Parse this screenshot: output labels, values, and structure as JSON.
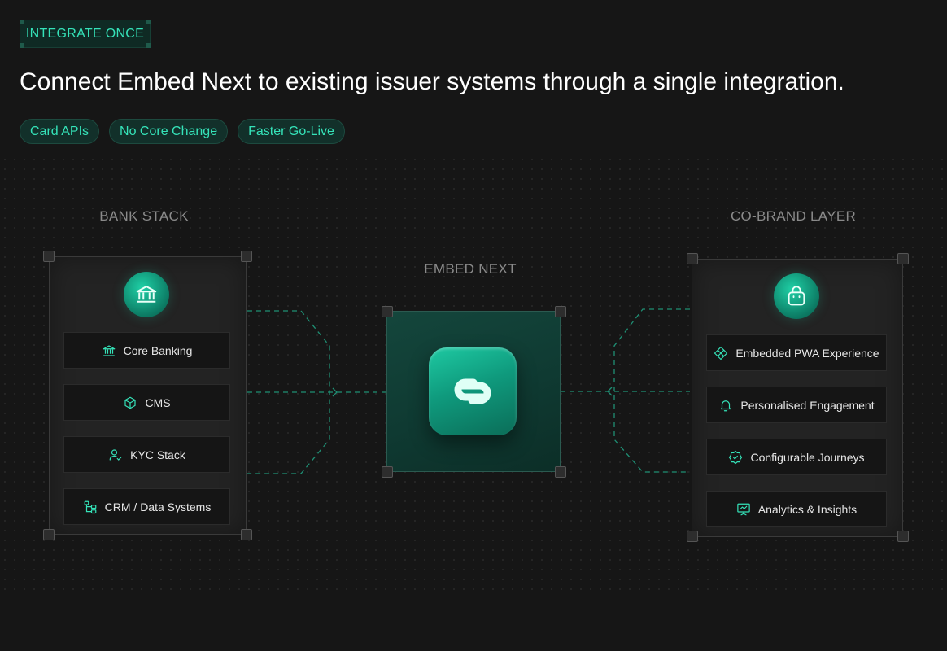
{
  "eyebrow": "INTEGRATE ONCE",
  "headline": "Connect Embed Next to existing issuer systems through a single integration.",
  "pills": [
    "Card APIs",
    "No Core Change",
    "Faster Go-Live"
  ],
  "bank_stack": {
    "title": "BANK STACK",
    "badge_icon": "bank-icon",
    "items": [
      {
        "label": "Core Banking",
        "icon": "bank-icon"
      },
      {
        "label": "CMS",
        "icon": "cube-icon"
      },
      {
        "label": "KYC Stack",
        "icon": "user-check-icon"
      },
      {
        "label": "CRM / Data Systems",
        "icon": "hierarchy-icon"
      }
    ]
  },
  "embed_next": {
    "title": "EMBED NEXT",
    "logo_icon": "embed-next-logo-icon"
  },
  "cobrand_layer": {
    "title": "CO-BRAND LAYER",
    "badge_icon": "shopping-bag-icon",
    "items": [
      {
        "label": "Embedded PWA Experience",
        "icon": "diamond-grid-icon"
      },
      {
        "label": "Personalised Engagement",
        "icon": "bell-icon"
      },
      {
        "label": "Configurable Journeys",
        "icon": "badge-check-icon"
      },
      {
        "label": "Analytics & Insights",
        "icon": "presentation-chart-icon"
      }
    ]
  },
  "colors": {
    "accent": "#35e3b9",
    "background": "#161616",
    "panel": "#232323",
    "row": "#151515",
    "teal_dark": "#0f3a32"
  }
}
